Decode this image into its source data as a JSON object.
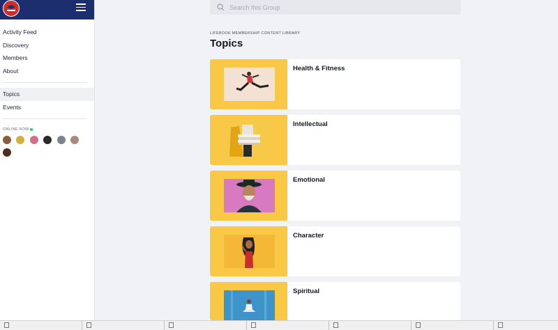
{
  "sidebar": {
    "logo_icon": "lifebook-logo",
    "menu_icon": "hamburger-menu-icon",
    "nav_primary": [
      {
        "label": "Activity Feed"
      },
      {
        "label": "Discovery"
      },
      {
        "label": "Members"
      },
      {
        "label": "About"
      }
    ],
    "nav_secondary": [
      {
        "label": "Topics",
        "active": true
      },
      {
        "label": "Events",
        "active": false
      }
    ],
    "online_label": "ONLINE NOW",
    "online_count_avatars": 7
  },
  "search": {
    "placeholder": "Search this Group",
    "icon": "search-icon"
  },
  "library": {
    "eyebrow": "LIFEBOOK MEMBERSHIP CONTENT LIBRARY",
    "title": "Topics"
  },
  "topics": [
    {
      "title": "Health & Fitness"
    },
    {
      "title": "Intellectual"
    },
    {
      "title": "Emotional"
    },
    {
      "title": "Character"
    },
    {
      "title": "Spiritual"
    }
  ],
  "colors": {
    "header_bg": "#1d2e6e",
    "thumb_bg": "#f9c847",
    "page_bg": "#f1f2f5",
    "online_dot": "#2ecc71"
  },
  "taskbar": {
    "items": [
      "",
      "",
      "",
      "",
      "",
      "",
      ""
    ]
  }
}
